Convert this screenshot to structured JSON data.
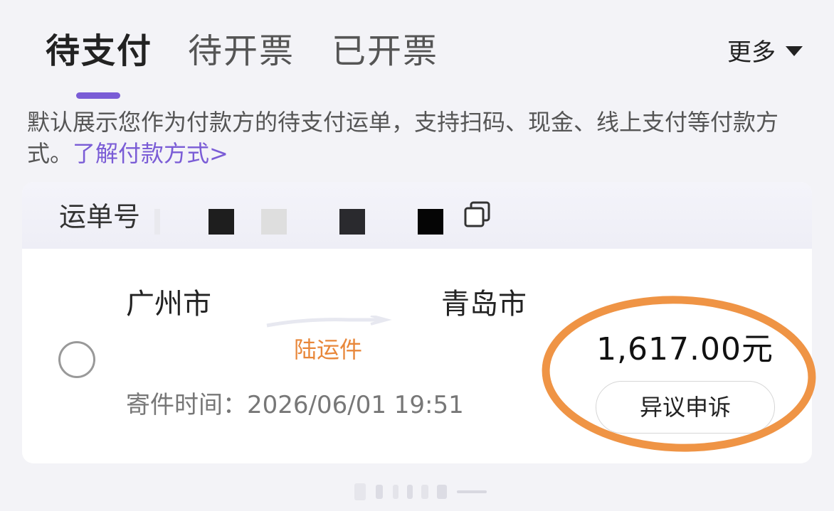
{
  "tabs": [
    {
      "label": "待支付",
      "active": true
    },
    {
      "label": "待开票",
      "active": false
    },
    {
      "label": "已开票",
      "active": false
    }
  ],
  "more_label": "更多",
  "more_icon": "caret-down-icon",
  "description": {
    "text": "默认展示您作为付款方的待支付运单，支持扫码、现金、线上支付等付款方式。",
    "link": "了解付款方式>"
  },
  "order": {
    "waybill_label": "运单号",
    "copy_icon": "copy-icon",
    "origin": "广州市",
    "destination": "青岛市",
    "service": "陆运件",
    "send_time": "寄件时间：2026/06/01 19:51",
    "price": "1,617.00元",
    "appeal_button": "异议申诉",
    "selected": false
  },
  "colors": {
    "accent": "#7a5cd6",
    "service": "#e8873a",
    "highlight": "#ef9445",
    "background": "#f3f3f7",
    "card": "#ffffff"
  }
}
